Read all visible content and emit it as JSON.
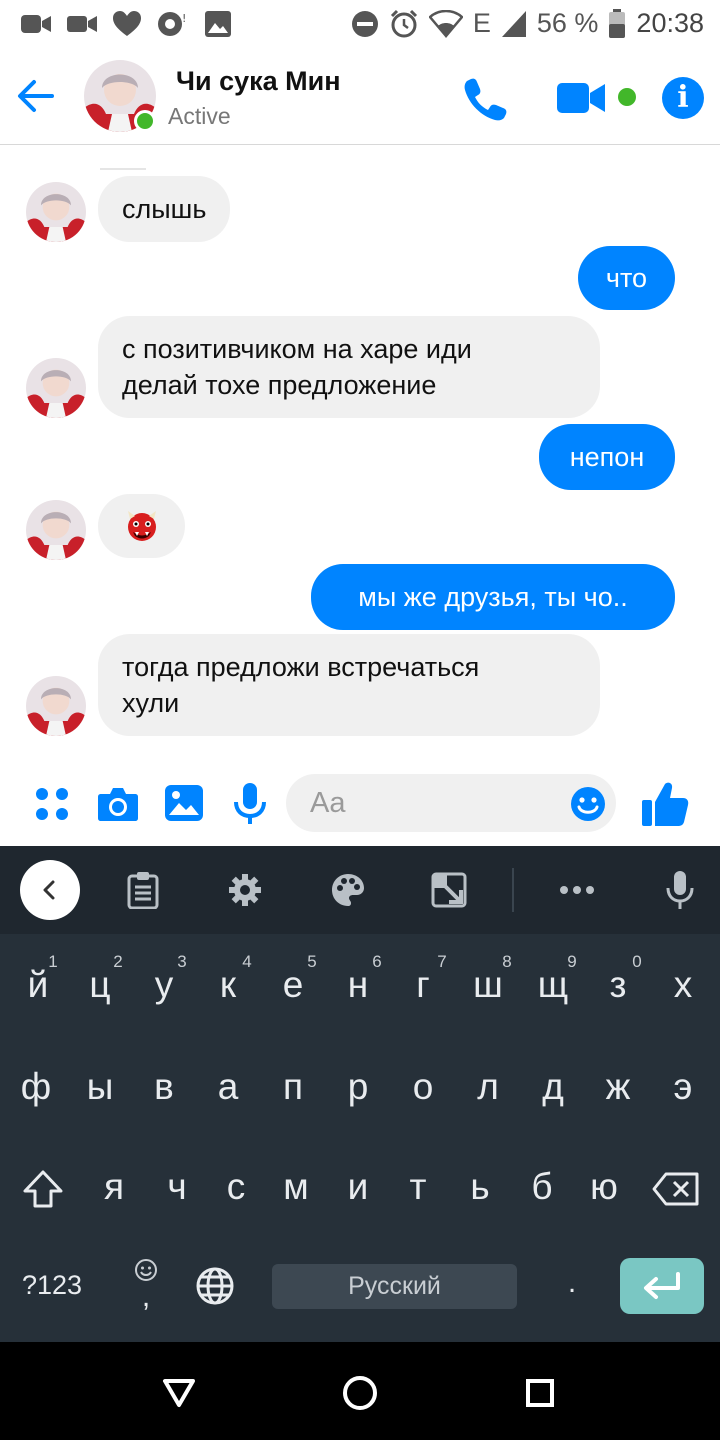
{
  "status_bar": {
    "battery_text": "56 %",
    "network_text": "E",
    "time": "20:38",
    "left_icons": [
      "messenger-video-icon",
      "video-camera-icon",
      "heart-icon",
      "voicemail-icon",
      "image-icon"
    ],
    "right_icons": [
      "dnd-icon",
      "alarm-icon",
      "wifi-icon",
      "signal-icon",
      "battery-icon"
    ]
  },
  "header": {
    "contact_name": "Чи сука Мин",
    "status": "Active",
    "accent_color": "#0084ff",
    "online_color": "#42b72a"
  },
  "messages": [
    {
      "side": "in",
      "text": "слышь",
      "avatar": true
    },
    {
      "side": "out",
      "text": "что"
    },
    {
      "side": "in",
      "lines": [
        "с позитивчиком на харе иди",
        "делай тохе предложение"
      ],
      "avatar": true
    },
    {
      "side": "out",
      "text": "непон"
    },
    {
      "side": "in",
      "emoji": "ogre",
      "avatar": true
    },
    {
      "side": "out",
      "text": "мы же друзья, ты чо.."
    },
    {
      "side": "in",
      "lines": [
        "тогда предложи встречаться",
        "хули"
      ],
      "avatar": true
    }
  ],
  "composer": {
    "placeholder": "Aa",
    "icons": [
      "apps-icon",
      "camera-icon",
      "gallery-icon",
      "microphone-icon",
      "emoji-icon",
      "thumbs-up-icon"
    ]
  },
  "keyboard": {
    "toolbar_icons": [
      "back-icon",
      "clipboard-icon",
      "settings-icon",
      "theme-palette-icon",
      "resize-icon",
      "more-icon",
      "voice-input-icon"
    ],
    "row1": [
      "й",
      "ц",
      "у",
      "к",
      "е",
      "н",
      "г",
      "ш",
      "щ",
      "з",
      "х"
    ],
    "row1_hints": [
      "1",
      "2",
      "3",
      "4",
      "5",
      "6",
      "7",
      "8",
      "9",
      "0"
    ],
    "row2": [
      "ф",
      "ы",
      "в",
      "а",
      "п",
      "р",
      "о",
      "л",
      "д",
      "ж",
      "э"
    ],
    "row3": [
      "я",
      "ч",
      "с",
      "м",
      "и",
      "т",
      "ь",
      "б",
      "ю"
    ],
    "mode_label": "?123",
    "comma": ",",
    "space_label": "Русский",
    "period": ".",
    "bg_color": "#263039",
    "enter_color": "#7ac7c3"
  },
  "nav_bar": {
    "icons": [
      "back-triangle-icon",
      "home-circle-icon",
      "recents-square-icon"
    ]
  }
}
